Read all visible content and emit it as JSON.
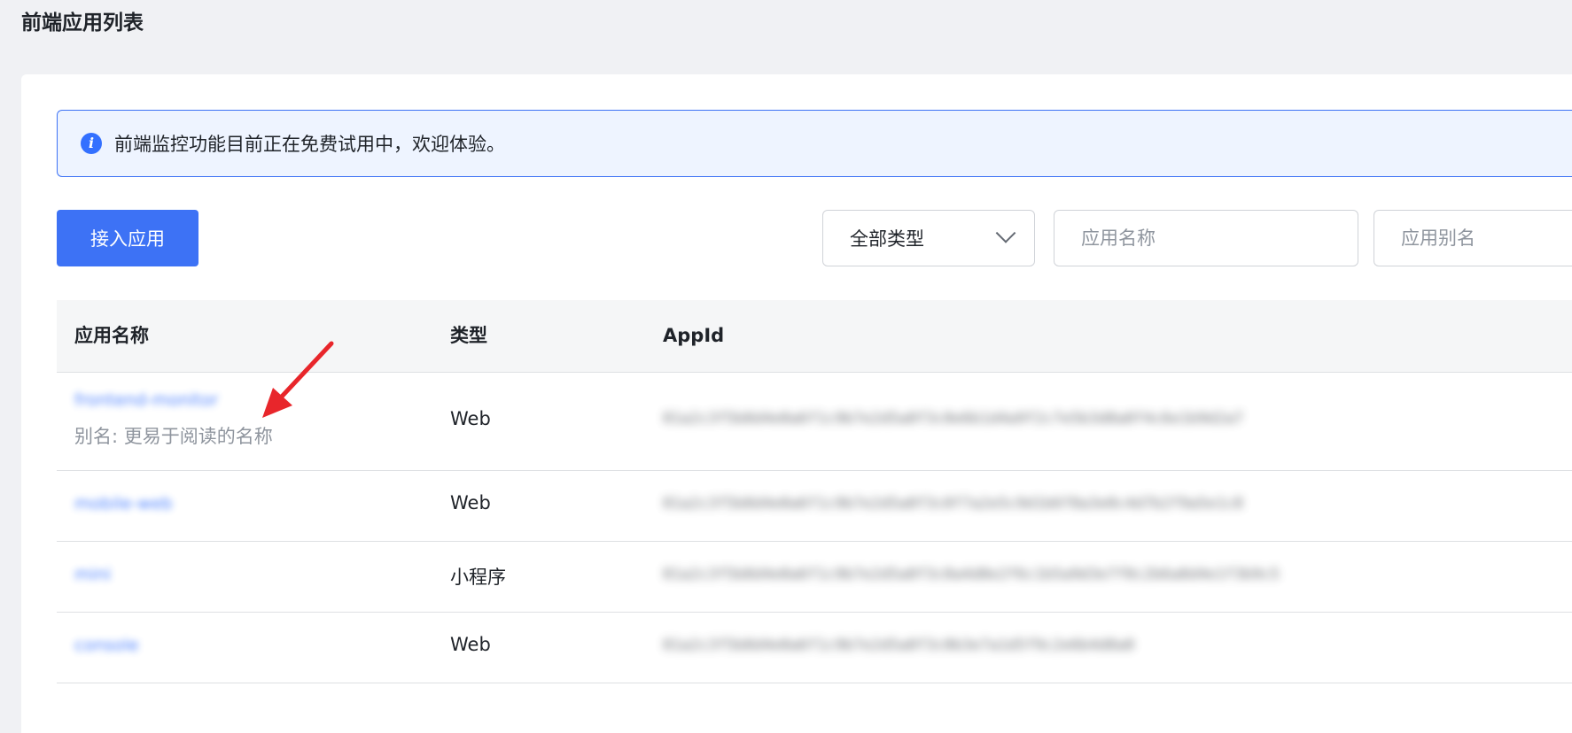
{
  "page": {
    "title": "前端应用列表"
  },
  "notice": {
    "icon": "info-icon",
    "text": "前端监控功能目前正在免费试用中，欢迎体验。"
  },
  "toolbar": {
    "add_button_label": "接入应用",
    "type_select": {
      "selected": "全部类型",
      "icon": "chevron-down-icon"
    },
    "app_name_input": {
      "value": "",
      "placeholder": "应用名称"
    },
    "app_alias_input": {
      "value": "",
      "placeholder": "应用别名"
    }
  },
  "table": {
    "columns": [
      "应用名称",
      "类型",
      "AppId"
    ],
    "rows": [
      {
        "name": "frontend-monitor",
        "alias": "别名: 更易于阅读的名称",
        "type": "Web",
        "appid": "01a2c3f5b8d4e0a6f1c9b7e2d5a8f3c0e6b1d4a9f2c7e5b3d8a0f4c6e1b9d2a7"
      },
      {
        "name": "mobile-web",
        "alias": "",
        "type": "Web",
        "appid": "01a2c3f5b8d4e0a6f1c9b7e2d5a8f3c0f7a2e5c9d1b6f8a3e0c4d7b2f9a5e1c8"
      },
      {
        "name": "mini",
        "alias": "",
        "type": "小程序",
        "appid": "01a2c3f5b8d4e0a6f1c9b7e2d5a8f3c0a4d8e2f6c1b5a9d3e7f0c2b6a8d4e1f3b9c5"
      },
      {
        "name": "console",
        "alias": "",
        "type": "Web",
        "appid": "01a2c3f5b8d4e0a6f1c9b7e2d5a8f3c0b3e7a1d5f9c2e6b4d8a0"
      }
    ]
  },
  "annotation": {
    "arrow_color": "#e8262b",
    "icon": "arrow-icon"
  }
}
